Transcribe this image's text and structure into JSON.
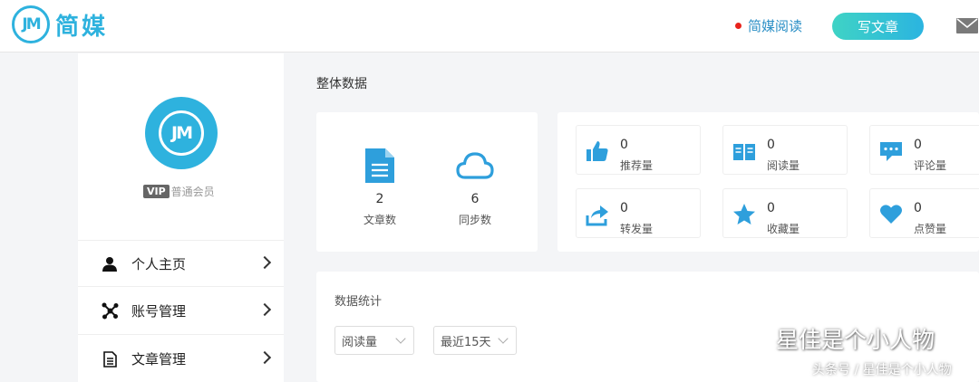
{
  "header": {
    "logo_text": "简媒",
    "logo_mark": "JM",
    "nav_read": "简媒阅读",
    "write_button": "写文章",
    "mail_icon": "mail-icon",
    "accent": "#2eb2de",
    "dot_color": "#e8231c"
  },
  "sidebar": {
    "avatar_mark": "JM",
    "vip_badge": "VIP",
    "member_level": "普通会员",
    "menu": [
      {
        "label": "个人主页",
        "icon": "user-icon"
      },
      {
        "label": "账号管理",
        "icon": "network-icon"
      },
      {
        "label": "文章管理",
        "icon": "document-icon"
      }
    ]
  },
  "main": {
    "section_title": "整体数据",
    "summary": [
      {
        "value": "2",
        "label": "文章数",
        "icon": "file-icon"
      },
      {
        "value": "6",
        "label": "同步数",
        "icon": "cloud-icon"
      }
    ],
    "metrics": [
      {
        "value": "0",
        "label": "推荐量",
        "icon": "thumbs-up-icon"
      },
      {
        "value": "0",
        "label": "阅读量",
        "icon": "book-icon"
      },
      {
        "value": "0",
        "label": "评论量",
        "icon": "comment-icon"
      },
      {
        "value": "0",
        "label": "转发量",
        "icon": "share-icon"
      },
      {
        "value": "0",
        "label": "收藏量",
        "icon": "star-icon"
      },
      {
        "value": "0",
        "label": "点赞量",
        "icon": "heart-icon"
      }
    ],
    "stats_title": "数据统计",
    "metric_select": "阅读量",
    "range_select": "最近15天"
  },
  "watermark": {
    "main": "星佳是个小人物",
    "sub": "头条号 / 星佳是个小人物"
  }
}
